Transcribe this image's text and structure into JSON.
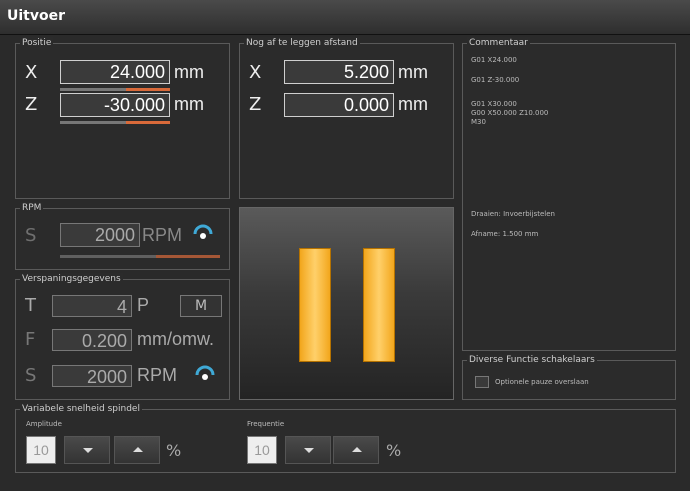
{
  "window": {
    "title": "Uitvoer"
  },
  "position": {
    "label": "Positie",
    "x": {
      "axis": "X",
      "value": "24.000",
      "unit": "mm"
    },
    "z": {
      "axis": "Z",
      "value": "-30.000",
      "unit": "mm"
    }
  },
  "remaining": {
    "label": "Nog af te leggen afstand",
    "x": {
      "axis": "X",
      "value": "5.200",
      "unit": "mm"
    },
    "z": {
      "axis": "Z",
      "value": "0.000",
      "unit": "mm"
    }
  },
  "spindle": {
    "label": "RPM",
    "axis": "S",
    "value": "2000",
    "unit": "RPM"
  },
  "machining": {
    "label": "Verspaningsgegevens",
    "t": {
      "axis": "T",
      "value": "4",
      "unit": "P",
      "button": "M"
    },
    "f": {
      "axis": "F",
      "value": "0.200",
      "unit": "mm/omw."
    },
    "s": {
      "axis": "S",
      "value": "2000",
      "unit": "RPM"
    }
  },
  "comment": {
    "label": "Commentaar",
    "lines": [
      "G01 X24.000",
      "G01 Z-30.000",
      "G01 X30.000",
      "G00 X50.000 Z10.000",
      "M30"
    ],
    "info1": "Draaien: Invoerbijstelen",
    "info2": "Afname: 1.500 mm"
  },
  "options": {
    "label": "Diverse Functie schakelaars",
    "checkbox_label": "Optionele pauze overslaan"
  },
  "variable_spindle": {
    "label": "Variabele snelheid spindel",
    "amplitude": {
      "label": "Amplitude",
      "value": "10",
      "unit": "%"
    },
    "frequency": {
      "label": "Frequentie",
      "value": "10",
      "unit": "%"
    }
  },
  "colors": {
    "accent": "#f2a61c",
    "progress": "#d96a3a",
    "gauge": "#3fa9d6"
  }
}
